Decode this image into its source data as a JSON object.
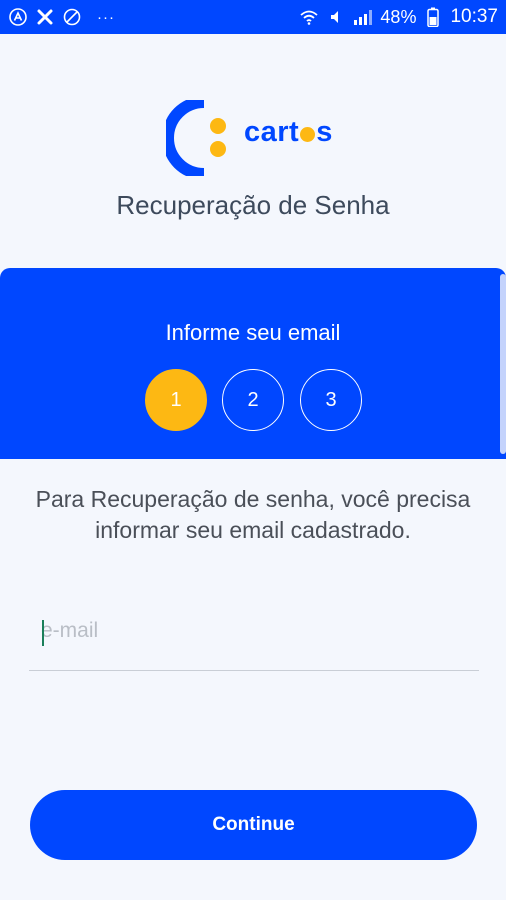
{
  "status_bar": {
    "dots": "···",
    "battery_percent": "48%",
    "time": "10:37",
    "left_icons": [
      "app-a-icon",
      "x-icon",
      "no-symbol-icon"
    ],
    "right_icons": [
      "wifi-icon",
      "mute-icon",
      "signal-icon",
      "battery-icon"
    ]
  },
  "logo": {
    "text_prefix": "cart",
    "text_suffix": "s",
    "brand_blue": "#0047ff",
    "brand_yellow": "#fdb813"
  },
  "page": {
    "title": "Recuperação de Senha"
  },
  "steps": {
    "title": "Informe seu email",
    "items": [
      {
        "label": "1",
        "active": true
      },
      {
        "label": "2",
        "active": false
      },
      {
        "label": "3",
        "active": false
      }
    ]
  },
  "instruction": {
    "text": "Para Recuperação de senha, você precisa informar seu email cadastrado."
  },
  "email": {
    "placeholder": "e-mail",
    "value": ""
  },
  "continue_button": {
    "label": "Continue"
  },
  "colors": {
    "primary": "#0047ff",
    "accent": "#fdb813",
    "background": "#f4f7fd"
  }
}
